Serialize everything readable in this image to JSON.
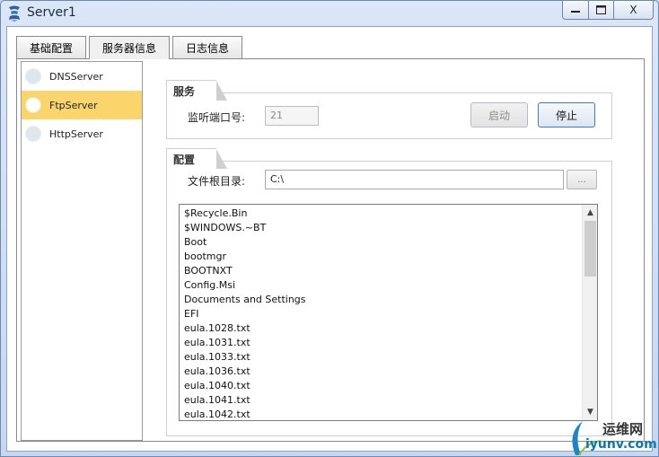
{
  "window": {
    "title": "Server1",
    "close_label": "X"
  },
  "tabs": [
    {
      "label": "基础配置",
      "active": false
    },
    {
      "label": "服务器信息",
      "active": true
    },
    {
      "label": "日志信息",
      "active": false
    }
  ],
  "server_list": [
    {
      "label": "DNSServer",
      "selected": false
    },
    {
      "label": "FtpServer",
      "selected": true
    },
    {
      "label": "HttpServer",
      "selected": false
    }
  ],
  "service": {
    "group_title": "服务",
    "port_label": "监听端口号:",
    "port_value": "21",
    "start_label": "启动",
    "stop_label": "停止"
  },
  "config": {
    "group_title": "配置",
    "root_label": "文件根目录:",
    "root_value": "C:\\",
    "browse_label": "..."
  },
  "files": [
    "$Recycle.Bin",
    "$WINDOWS.~BT",
    "Boot",
    "bootmgr",
    "BOOTNXT",
    "Config.Msi",
    "Documents and Settings",
    "EFI",
    "eula.1028.txt",
    "eula.1031.txt",
    "eula.1033.txt",
    "eula.1036.txt",
    "eula.1040.txt",
    "eula.1041.txt",
    "eula.1042.txt"
  ],
  "watermark": {
    "line1": "运维网",
    "line2": "iyunv.com"
  },
  "colors": {
    "selected_item": "#f9d56c",
    "watermark_blue": "#0a76b8"
  }
}
